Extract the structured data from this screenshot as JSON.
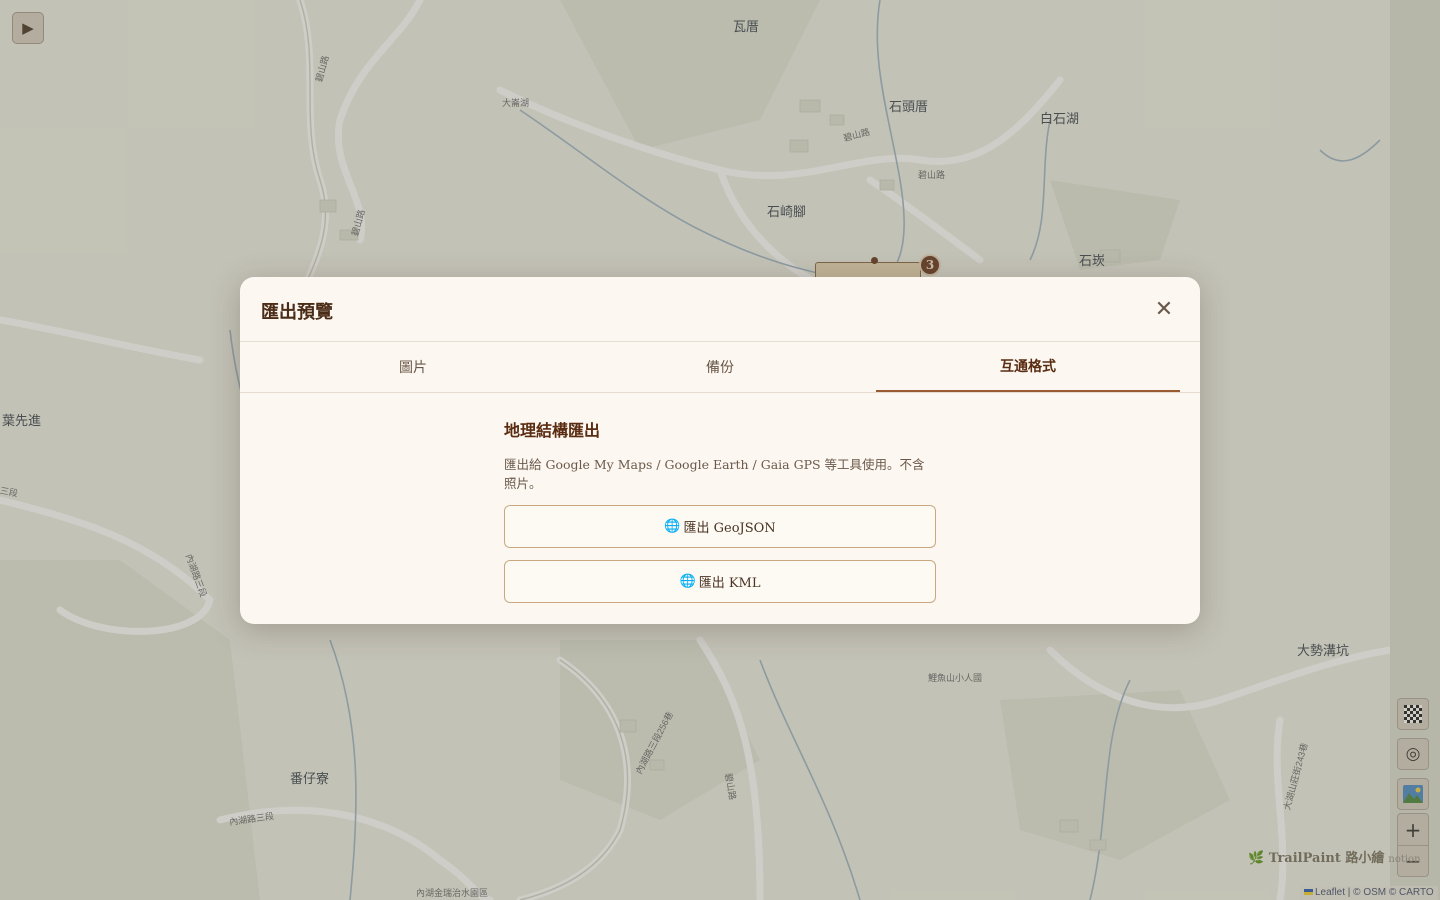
{
  "map": {
    "labels": {
      "walei": "瓦厝",
      "shitoucuo": "石頭厝",
      "baishihu": "白石湖",
      "shiqijiao": "石崎腳",
      "shitan": "石崁",
      "yexianjin": "葉先進",
      "fanzailiao": "番仔寮",
      "dashigoukeng": "大勢溝坑",
      "bishan_road_1": "碧山路",
      "bishan_road_2": "碧山路",
      "bishan_road_3": "碧山路",
      "bishan_road_4": "碧山路",
      "bishan_road_5": "碧山路",
      "dabei_lake": "大崙湖",
      "liyushan": "鯉魚山小人國",
      "neihu_road_3_256": "內湖路三段256巷",
      "neihu_road_3": "內湖路三段",
      "neihu_road_3_b": "內湖路三段",
      "neihu_road_3_c": "三段",
      "dahu_road_243": "大湖山莊街243巷",
      "neihu_jinrui": "內湖金瑞治水園區"
    },
    "marker_number": "3"
  },
  "controls": {
    "play_icon": "▶",
    "target_icon": "◎",
    "zoom_in": "+",
    "zoom_out": "−"
  },
  "watermark": {
    "brand": "🌿 TrailPaint 路小繪",
    "sub": "notion"
  },
  "attribution": {
    "leaflet": "Leaflet",
    "sep": " | © OSM © CARTO"
  },
  "modal": {
    "title": "匯出預覽",
    "close_icon": "✕",
    "tabs": {
      "image": "圖片",
      "backup": "備份",
      "interop": "互通格式"
    },
    "active_tab": "interop",
    "section_title": "地理結構匯出",
    "section_desc": "匯出給 Google My Maps / Google Earth / Gaia GPS 等工具使用。不含照片。",
    "buttons": {
      "geojson": "匯出 GeoJSON",
      "kml": "匯出 KML"
    },
    "globe_icon": "🌐"
  },
  "colors": {
    "accent": "#9a5a32",
    "title": "#4a2c17",
    "button_border": "#c9a880",
    "modal_bg": "#fcf7f0"
  }
}
